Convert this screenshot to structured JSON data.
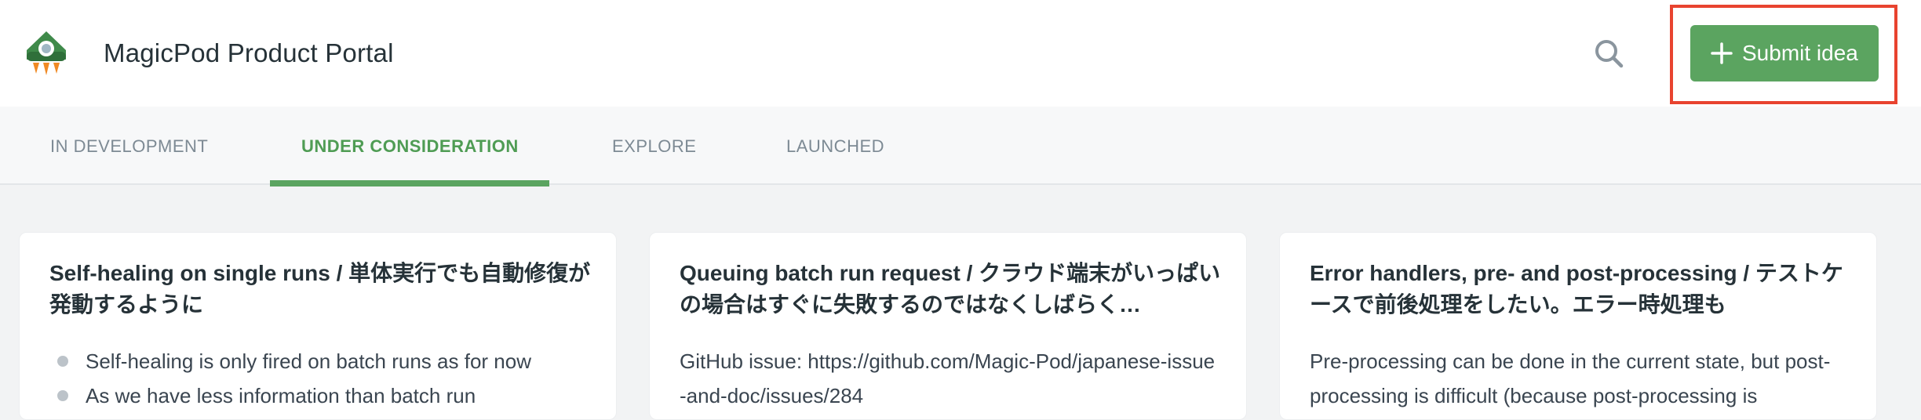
{
  "header": {
    "app_title": "MagicPod Product Portal",
    "logo_icon": "rocket-logo-icon",
    "search_icon": "search-icon",
    "submit_label": "Submit idea",
    "submit_icon": "plus-icon",
    "accent_color": "#5ba460",
    "highlight_color": "#e8432f"
  },
  "tabs": [
    {
      "label": "IN DEVELOPMENT",
      "active": false
    },
    {
      "label": "UNDER CONSIDERATION",
      "active": true
    },
    {
      "label": "EXPLORE",
      "active": false
    },
    {
      "label": "LAUNCHED",
      "active": false
    }
  ],
  "cards": [
    {
      "title": "Self-healing on single runs / 単体実行でも自動修復が発動するように",
      "bullets": [
        "Self-healing is only fired on batch runs as for now",
        "As we have less information than batch run"
      ]
    },
    {
      "title": "Queuing batch run request / クラウド端末がいっぱいの場合はすぐに失敗するのではなくしばらく…",
      "body": "GitHub issue: https://github.com/Magic-Pod/japanese-issue-and-doc/issues/284"
    },
    {
      "title": "Error handlers, pre- and post-processing / テストケースで前後処理をしたい。エラー時処理も",
      "body": "Pre-processing can be done in the current state, but post-processing is difficult (because post-processing is"
    }
  ]
}
